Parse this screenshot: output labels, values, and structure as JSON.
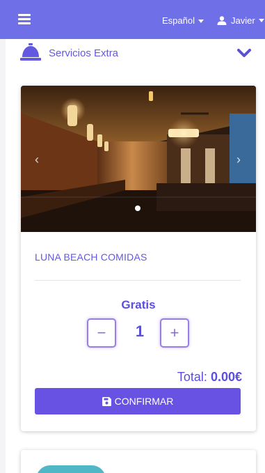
{
  "header": {
    "language": "Español",
    "user_name": "Javier"
  },
  "section": {
    "title": "Servicios Extra",
    "icon": "concierge-bell-icon"
  },
  "product": {
    "name": "LUNA BEACH COMIDAS",
    "price_label": "Gratis",
    "quantity": "1",
    "decrement_label": "−",
    "increment_label": "+",
    "total_label": "Total:",
    "total_value": "0.00€",
    "confirm_label": "CONFIRMAR",
    "carousel": {
      "prev_label": "‹",
      "next_label": "›",
      "slides": 1,
      "active_slide": 1
    }
  },
  "colors": {
    "topbar": "#6f6fe8",
    "accent": "#6359e0",
    "button": "#6852e3"
  }
}
